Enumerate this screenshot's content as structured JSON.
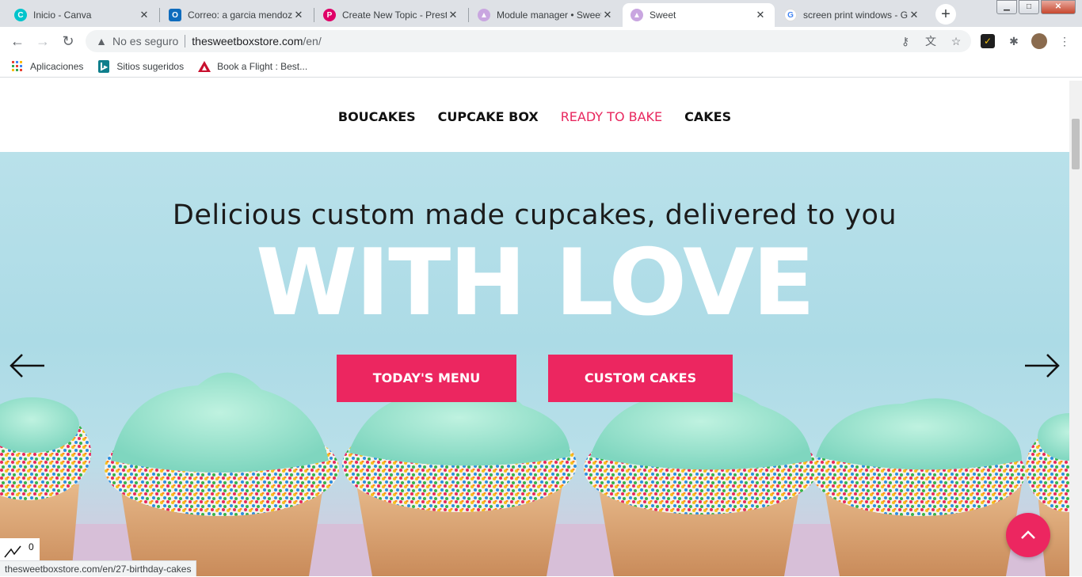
{
  "browser": {
    "tabs": [
      {
        "label": "Inicio - Canva",
        "icon": "canva-icon",
        "icon_glyph": "C",
        "icon_color": "#00c4cc"
      },
      {
        "label": "Correo: a garcia mendoza",
        "icon": "outlook-icon",
        "icon_glyph": "O",
        "icon_color": "#0f6cbd"
      },
      {
        "label": "Create New Topic - Presta",
        "icon": "prestashop-icon",
        "icon_glyph": "P",
        "icon_color": "#df0067"
      },
      {
        "label": "Module manager • Sweet",
        "icon": "cupcake-icon",
        "icon_glyph": "●",
        "icon_color": "#b58ad1"
      },
      {
        "label": "Sweet",
        "icon": "cupcake-icon",
        "icon_glyph": "●",
        "icon_color": "#b58ad1"
      },
      {
        "label": "screen print windows - Go",
        "icon": "google-icon",
        "icon_glyph": "G",
        "icon_color": "#4285f4"
      }
    ],
    "active_tab_index": 4,
    "new_tab_label": "+",
    "omnibox": {
      "security_text": "No es seguro",
      "domain": "thesweetboxstore.com",
      "path": "/en/"
    },
    "bookmarks": [
      {
        "label": "Aplicaciones",
        "icon": "apps-grid-icon"
      },
      {
        "label": "Sitios sugeridos",
        "icon": "bing-icon"
      },
      {
        "label": "Book a Flight : Best...",
        "icon": "airline-icon"
      }
    ],
    "status_url": "thesweetboxstore.com/en/27-birthday-cakes"
  },
  "site": {
    "nav": [
      {
        "label": "BOUCAKES",
        "active": false
      },
      {
        "label": "CUPCAKE BOX",
        "active": false
      },
      {
        "label": "READY TO BAKE",
        "active": true
      },
      {
        "label": "CAKES",
        "active": false
      }
    ],
    "hero": {
      "subtitle": "Delicious custom made cupcakes, delivered to you",
      "headline": "WITH LOVE",
      "buttons": [
        "TODAY'S MENU",
        "CUSTOM CAKES"
      ]
    },
    "widget_count": "0",
    "accent_color": "#ec2660"
  }
}
